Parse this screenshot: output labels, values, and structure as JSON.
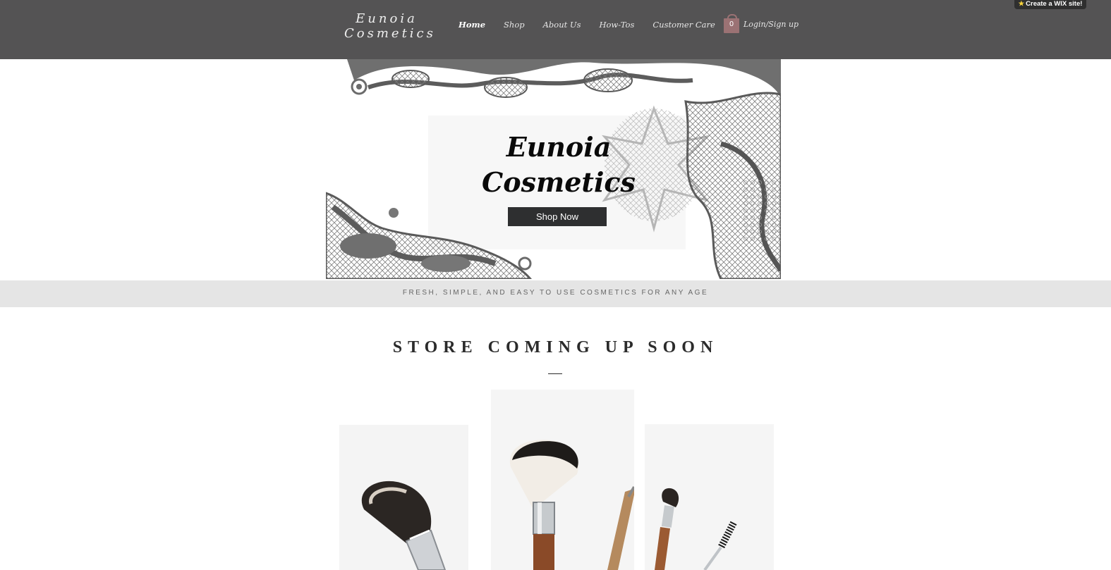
{
  "header": {
    "logo_line1": "Eunoia",
    "logo_line2": "Cosmetics",
    "nav": [
      {
        "label": "Home"
      },
      {
        "label": "Shop"
      },
      {
        "label": "About Us"
      },
      {
        "label": "How-Tos"
      },
      {
        "label": "Customer Care"
      }
    ],
    "cart_count": "0",
    "login_label": "Login/Sign up",
    "wix_badge": "Create a WIX site!"
  },
  "hero": {
    "title_line1": "Eunoia",
    "title_line2": "Cosmetics",
    "button_label": "Shop Now"
  },
  "tagline": "FRESH, SIMPLE, AND EASY TO USE COSMETICS FOR ANY AGE",
  "section": {
    "title": "STORE COMING UP SOON"
  },
  "colors": {
    "header_bg": "#545354",
    "cart_accent": "#9b7274",
    "button_bg": "#2e2f30",
    "strip_bg": "#e5e5e5"
  },
  "icons": [
    "star-icon",
    "cart-icon",
    "lace-decoration",
    "makeup-brush-photo"
  ]
}
